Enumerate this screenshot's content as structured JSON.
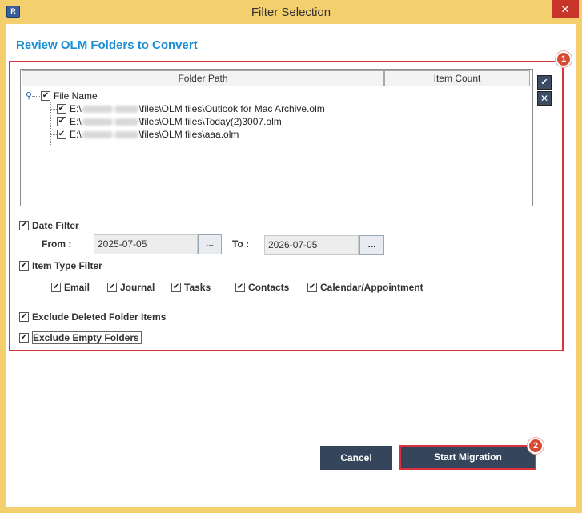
{
  "window": {
    "title": "Filter Selection",
    "app_icon_letter": "R",
    "close_label": "✕"
  },
  "heading": "Review OLM Folders to Convert",
  "badges": {
    "filters": "1",
    "start": "2"
  },
  "table": {
    "columns": [
      "Folder Path",
      "Item Count"
    ],
    "root_label": "File Name",
    "files": [
      {
        "prefix": "E:\\",
        "suffix": "\\files\\OLM files\\Outlook for Mac Archive.olm",
        "checked": true
      },
      {
        "prefix": "E:\\",
        "suffix": "\\files\\OLM files\\Today(2)3007.olm",
        "checked": true
      },
      {
        "prefix": "E:\\",
        "suffix": "\\files\\OLM files\\aaa.olm",
        "checked": true
      }
    ],
    "select_all_icon": "check-all-icon",
    "deselect_all_icon": "clear-all-icon"
  },
  "date_filter": {
    "label": "Date Filter",
    "checked": true,
    "from_label": "From :",
    "from_value": "2025-07-05",
    "to_label": "To :",
    "to_value": "2026-07-05",
    "picker_label": "..."
  },
  "item_type_filter": {
    "label": "Item Type Filter",
    "checked": true,
    "types": [
      "Email",
      "Journal",
      "Tasks",
      "Contacts",
      "Calendar/Appointment"
    ]
  },
  "exclude_deleted": {
    "label": "Exclude Deleted Folder Items",
    "checked": true
  },
  "exclude_empty": {
    "label": "Exclude Empty Folders",
    "checked": true
  },
  "buttons": {
    "cancel": "Cancel",
    "start": "Start Migration"
  },
  "colors": {
    "accent": "#1b8fd2",
    "highlight": "#d9333f",
    "button": "#34455c",
    "frame": "#f3cf6d"
  }
}
